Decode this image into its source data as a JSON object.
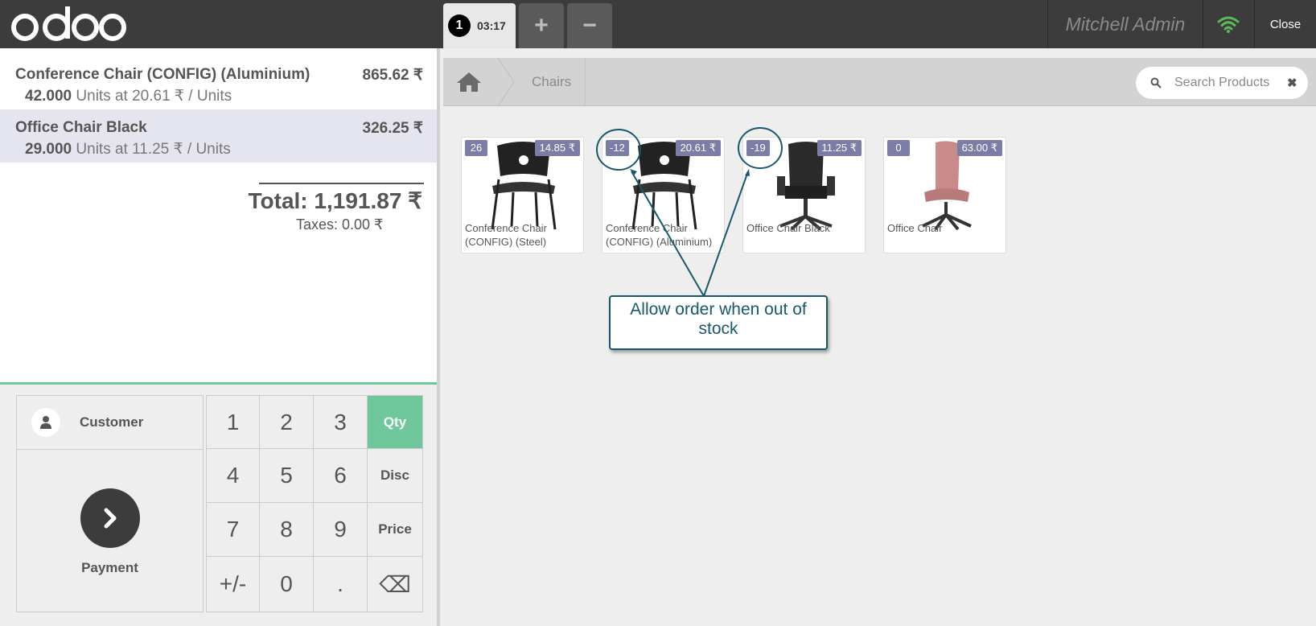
{
  "topbar": {
    "logo": "odoo",
    "order_number": "1",
    "order_time": "03:17",
    "add_order_label": "+",
    "remove_order_label": "−",
    "user_name": "Mitchell Admin",
    "close_label": "Close",
    "wifi_icon": "wifi-icon",
    "wifi_color": "#5cb85c"
  },
  "order": {
    "lines": [
      {
        "name": "Conference Chair (CONFIG) (Aluminium)",
        "price": "865.62 ₹",
        "qty": "42.000",
        "unit_info": "Units at 20.61 ₹ / Units",
        "selected": false
      },
      {
        "name": "Office Chair Black",
        "price": "326.25 ₹",
        "qty": "29.000",
        "unit_info": "Units at 11.25 ₹ / Units",
        "selected": true
      }
    ],
    "total": "Total: 1,191.87 ₹",
    "taxes": "Taxes: 0.00 ₹"
  },
  "pad": {
    "customer_label": "Customer",
    "payment_label": "Payment",
    "keys": [
      "1",
      "2",
      "3",
      "Qty",
      "4",
      "5",
      "6",
      "Disc",
      "7",
      "8",
      "9",
      "Price",
      "+/-",
      "0",
      ".",
      "⌫"
    ],
    "active_mode": "Qty",
    "accent_color": "#6ec89b"
  },
  "breadcrumb": {
    "home_icon": "home-icon",
    "category": "Chairs"
  },
  "search": {
    "placeholder": "Search Products",
    "clear_icon": "close-icon"
  },
  "products": [
    {
      "name": "Conference Chair (CONFIG) (Steel)",
      "qty": "26",
      "price": "14.85 ₹"
    },
    {
      "name": "Conference Chair (CONFIG) (Aluminium)",
      "qty": "-12",
      "price": "20.61 ₹"
    },
    {
      "name": "Office Chair Black",
      "qty": "-19",
      "price": "11.25 ₹"
    },
    {
      "name": "Office Chair",
      "qty": "0",
      "price": "63.00 ₹"
    }
  ],
  "annotation": {
    "text": "Allow order when out of stock",
    "color": "#17586b"
  }
}
